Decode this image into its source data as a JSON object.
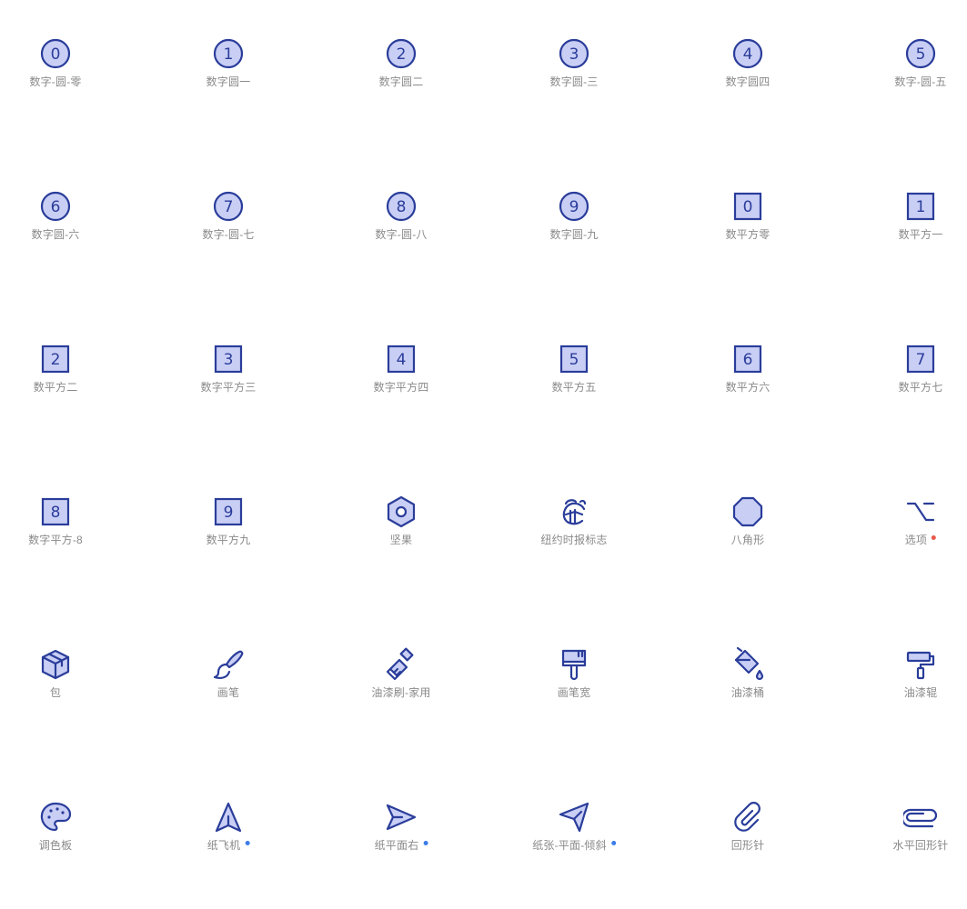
{
  "colors": {
    "stroke": "#2a3d9a",
    "fill": "#c9cef5",
    "label": "#8a8a8a",
    "dot_blue": "#3b7de8",
    "dot_red": "#e8594a"
  },
  "rows": [
    [
      {
        "label": "数字-圆-零",
        "icon": "number-circle-0-icon",
        "kind": "circle",
        "num": "0"
      },
      {
        "label": "数字圆一",
        "icon": "number-circle-1-icon",
        "kind": "circle",
        "num": "1"
      },
      {
        "label": "数字圆二",
        "icon": "number-circle-2-icon",
        "kind": "circle",
        "num": "2"
      },
      {
        "label": "数字圆-三",
        "icon": "number-circle-3-icon",
        "kind": "circle",
        "num": "3"
      },
      {
        "label": "数字圆四",
        "icon": "number-circle-4-icon",
        "kind": "circle",
        "num": "4"
      },
      {
        "label": "数字-圆-五",
        "icon": "number-circle-5-icon",
        "kind": "circle",
        "num": "5"
      }
    ],
    [
      {
        "label": "数字圆-六",
        "icon": "number-circle-6-icon",
        "kind": "circle",
        "num": "6"
      },
      {
        "label": "数字-圆-七",
        "icon": "number-circle-7-icon",
        "kind": "circle",
        "num": "7"
      },
      {
        "label": "数字-圆-八",
        "icon": "number-circle-8-icon",
        "kind": "circle",
        "num": "8"
      },
      {
        "label": "数字圆-九",
        "icon": "number-circle-9-icon",
        "kind": "circle",
        "num": "9"
      },
      {
        "label": "数平方零",
        "icon": "number-square-0-icon",
        "kind": "square",
        "num": "0"
      },
      {
        "label": "数平方一",
        "icon": "number-square-1-icon",
        "kind": "square",
        "num": "1"
      }
    ],
    [
      {
        "label": "数平方二",
        "icon": "number-square-2-icon",
        "kind": "square",
        "num": "2"
      },
      {
        "label": "数字平方三",
        "icon": "number-square-3-icon",
        "kind": "square",
        "num": "3"
      },
      {
        "label": "数字平方四",
        "icon": "number-square-4-icon",
        "kind": "square",
        "num": "4"
      },
      {
        "label": "数平方五",
        "icon": "number-square-5-icon",
        "kind": "square",
        "num": "5"
      },
      {
        "label": "数平方六",
        "icon": "number-square-6-icon",
        "kind": "square",
        "num": "6"
      },
      {
        "label": "数平方七",
        "icon": "number-square-7-icon",
        "kind": "square",
        "num": "7"
      }
    ],
    [
      {
        "label": "数字平方-8",
        "icon": "number-square-8-icon",
        "kind": "square",
        "num": "8"
      },
      {
        "label": "数平方九",
        "icon": "number-square-9-icon",
        "kind": "square",
        "num": "9"
      },
      {
        "label": "坚果",
        "icon": "nut-icon",
        "kind": "nut"
      },
      {
        "label": "纽约时报标志",
        "icon": "nyt-logo-icon",
        "kind": "nyt"
      },
      {
        "label": "八角形",
        "icon": "octagon-icon",
        "kind": "octagon"
      },
      {
        "label": "选项",
        "icon": "option-key-icon",
        "kind": "option",
        "dot": "red"
      }
    ],
    [
      {
        "label": "包",
        "icon": "package-icon",
        "kind": "package"
      },
      {
        "label": "画笔",
        "icon": "paintbrush-icon",
        "kind": "brush"
      },
      {
        "label": "油漆刷-家用",
        "icon": "paintbrush-household-icon",
        "kind": "brush2"
      },
      {
        "label": "画笔宽",
        "icon": "paintbrush-broad-icon",
        "kind": "broad"
      },
      {
        "label": "油漆桶",
        "icon": "paint-bucket-icon",
        "kind": "bucket"
      },
      {
        "label": "油漆辊",
        "icon": "paint-roller-icon",
        "kind": "roller"
      }
    ],
    [
      {
        "label": "调色板",
        "icon": "palette-icon",
        "kind": "palette"
      },
      {
        "label": "纸飞机",
        "icon": "paper-plane-icon",
        "kind": "plane",
        "dot": "blue"
      },
      {
        "label": "纸平面右",
        "icon": "paper-plane-right-icon",
        "kind": "planeright",
        "dot": "blue"
      },
      {
        "label": "纸张-平面-倾斜",
        "icon": "paper-plane-tilt-icon",
        "kind": "planetilt",
        "dot": "blue"
      },
      {
        "label": "回形针",
        "icon": "paperclip-icon",
        "kind": "clip"
      },
      {
        "label": "水平回形针",
        "icon": "paperclip-horizontal-icon",
        "kind": "cliph"
      }
    ]
  ]
}
